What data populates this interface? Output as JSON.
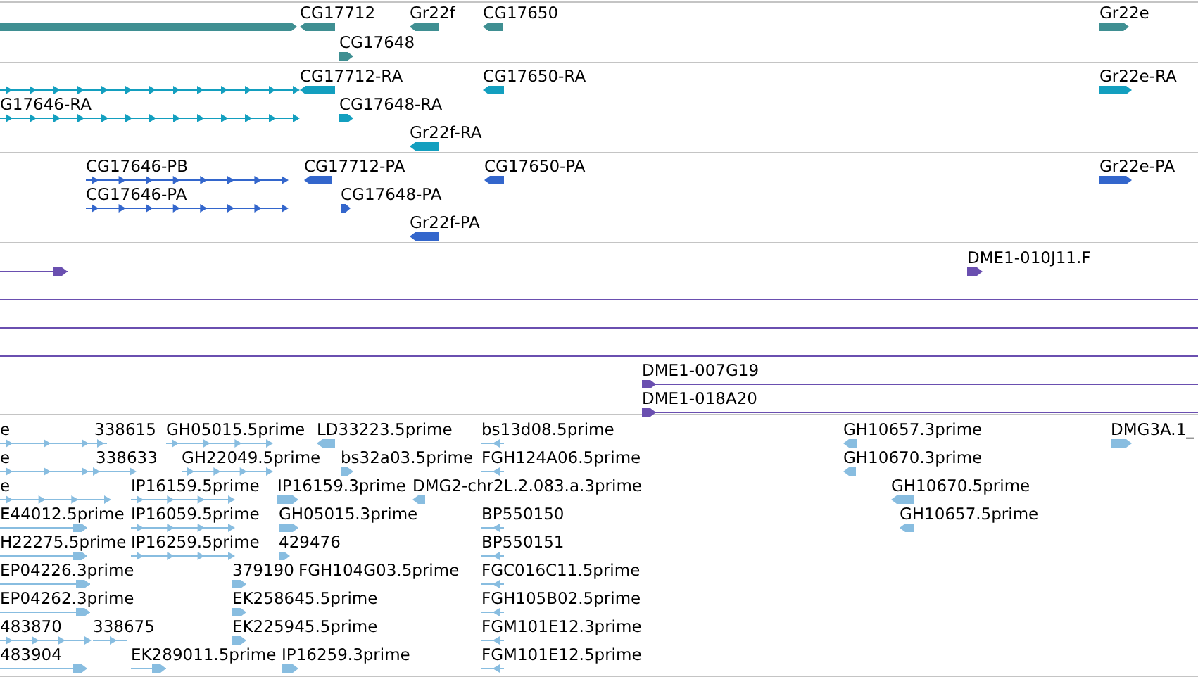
{
  "tracks": [
    {
      "color": "#3f8f92",
      "features": [
        {
          "kind": "block",
          "reverse": false
        },
        {
          "label": "CG17712",
          "kind": "block",
          "reverse": true
        },
        {
          "label": "Gr22f",
          "kind": "block",
          "reverse": true
        },
        {
          "label": "CG17650",
          "kind": "block",
          "reverse": true
        },
        {
          "label": "Gr22e",
          "kind": "block",
          "reverse": false
        },
        {
          "label": "CG17648",
          "kind": "block",
          "reverse": false
        }
      ]
    },
    {
      "color": "#139fbf",
      "features": [
        {
          "kind": "transcript",
          "reverse": false
        },
        {
          "label": "CG17712-RA",
          "kind": "block",
          "reverse": true
        },
        {
          "label": "CG17650-RA",
          "kind": "block",
          "reverse": true
        },
        {
          "label": "Gr22e-RA",
          "kind": "block",
          "reverse": false
        },
        {
          "label": "G17646-RA",
          "kind": "transcript",
          "reverse": false
        },
        {
          "label": "CG17648-RA",
          "kind": "block",
          "reverse": false
        },
        {
          "label": "Gr22f-RA",
          "kind": "block",
          "reverse": true
        }
      ]
    },
    {
      "color": "#3366cc",
      "features": [
        {
          "label": "CG17646-PB",
          "kind": "transcript",
          "reverse": false
        },
        {
          "label": "CG17712-PA",
          "kind": "block",
          "reverse": true
        },
        {
          "label": "CG17650-PA",
          "kind": "block",
          "reverse": true
        },
        {
          "label": "Gr22e-PA",
          "kind": "block",
          "reverse": false
        },
        {
          "label": "CG17646-PA",
          "kind": "transcript",
          "reverse": false
        },
        {
          "label": "CG17648-PA",
          "kind": "block",
          "reverse": false
        },
        {
          "label": "Gr22f-PA",
          "kind": "block",
          "reverse": true
        }
      ]
    },
    {
      "color": "#6a4fb0",
      "features": [
        {
          "kind": "line",
          "reverse": false
        },
        {
          "label": "DME1-010J11.F",
          "kind": "block",
          "reverse": false
        },
        {
          "kind": "line"
        },
        {
          "kind": "line"
        },
        {
          "kind": "line"
        },
        {
          "label": "DME1-007G19",
          "kind": "line",
          "reverse": false
        },
        {
          "label": "DME1-018A20",
          "kind": "line",
          "reverse": false
        }
      ]
    },
    {
      "color": "#88bde0",
      "features": [
        {
          "label": "e",
          "kind": "transcript",
          "reverse": false
        },
        {
          "label": "338615",
          "kind": "transcript",
          "reverse": false
        },
        {
          "label": "GH05015.5prime",
          "kind": "transcript",
          "reverse": false
        },
        {
          "label": "LD33223.5prime",
          "kind": "block",
          "reverse": true
        },
        {
          "label": "bs13d08.5prime",
          "kind": "transcript",
          "reverse": true
        },
        {
          "label": "GH10657.3prime",
          "kind": "block",
          "reverse": true
        },
        {
          "label": "DMG3A.1_",
          "kind": "block",
          "reverse": false
        },
        {
          "label": "e",
          "kind": "transcript",
          "reverse": false
        },
        {
          "label": "338633",
          "kind": "transcript",
          "reverse": false
        },
        {
          "label": "GH22049.5prime",
          "kind": "transcript",
          "reverse": false
        },
        {
          "label": "bs32a03.5prime",
          "kind": "block",
          "reverse": false
        },
        {
          "label": "FGH124A06.5prime",
          "kind": "transcript",
          "reverse": true
        },
        {
          "label": "GH10670.3prime",
          "kind": "block",
          "reverse": true
        },
        {
          "label": "e",
          "kind": "transcript",
          "reverse": false
        },
        {
          "label": "IP16159.5prime",
          "kind": "transcript",
          "reverse": false
        },
        {
          "label": "IP16159.3prime",
          "kind": "block",
          "reverse": false
        },
        {
          "label": "DMG2-chr2L.2.083.a.3prime",
          "kind": "block",
          "reverse": true
        },
        {
          "label": "GH10670.5prime",
          "kind": "block",
          "reverse": true
        },
        {
          "label": "E44012.5prime",
          "kind": "line",
          "reverse": false
        },
        {
          "label": "IP16059.5prime",
          "kind": "transcript",
          "reverse": false
        },
        {
          "label": "GH05015.3prime",
          "kind": "block",
          "reverse": false
        },
        {
          "label": "BP550150",
          "kind": "transcript",
          "reverse": true
        },
        {
          "label": "GH10657.5prime",
          "kind": "block",
          "reverse": true
        },
        {
          "label": "H22275.5prime",
          "kind": "line",
          "reverse": false
        },
        {
          "label": "IP16259.5prime",
          "kind": "transcript",
          "reverse": false
        },
        {
          "label": "429476",
          "kind": "block",
          "reverse": false
        },
        {
          "label": "BP550151",
          "kind": "transcript",
          "reverse": true
        },
        {
          "label": "EP04226.3prime",
          "kind": "line",
          "reverse": false
        },
        {
          "label": "379190",
          "kind": "block",
          "reverse": false
        },
        {
          "label": "FGH104G03.5prime"
        },
        {
          "label": "FGC016C11.5prime",
          "kind": "transcript",
          "reverse": true
        },
        {
          "label": "EP04262.3prime",
          "kind": "line",
          "reverse": false
        },
        {
          "label": "EK258645.5prime",
          "kind": "block",
          "reverse": false
        },
        {
          "label": "FGH105B02.5prime",
          "kind": "transcript",
          "reverse": true
        },
        {
          "label": "483870",
          "kind": "transcript",
          "reverse": false
        },
        {
          "label": "338675",
          "kind": "transcript",
          "reverse": false
        },
        {
          "label": "EK225945.5prime",
          "kind": "block",
          "reverse": false
        },
        {
          "label": "FGM101E12.3prime",
          "kind": "transcript",
          "reverse": true
        },
        {
          "label": "483904",
          "kind": "line",
          "reverse": false
        },
        {
          "label": "EK289011.5prime",
          "kind": "line",
          "reverse": false
        },
        {
          "label": "IP16259.3prime",
          "kind": "block",
          "reverse": false
        },
        {
          "label": "FGM101E12.5prime",
          "kind": "transcript",
          "reverse": true
        }
      ]
    }
  ]
}
